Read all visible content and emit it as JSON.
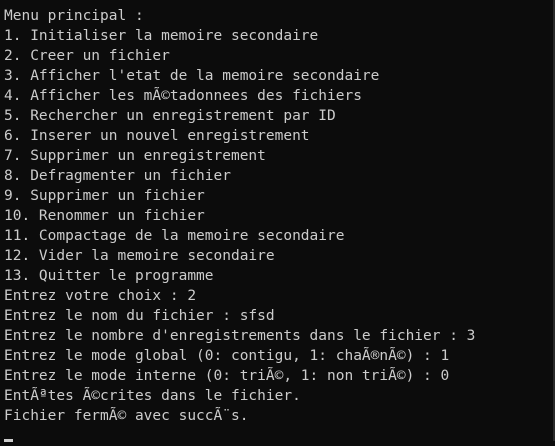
{
  "console": {
    "lines": [
      "Menu principal :",
      "1. Initialiser la memoire secondaire",
      "2. Creer un fichier",
      "3. Afficher l'etat de la memoire secondaire",
      "4. Afficher les mÃ©tadonnees des fichiers",
      "5. Rechercher un enregistrement par ID",
      "6. Inserer un nouvel enregistrement",
      "7. Supprimer un enregistrement",
      "8. Defragmenter un fichier",
      "9. Supprimer un fichier",
      "10. Renommer un fichier",
      "11. Compactage de la memoire secondaire",
      "12. Vider la memoire secondaire",
      "13. Quitter le programme",
      "Entrez votre choix : 2",
      "Entrez le nom du fichier : sfsd",
      "Entrez le nombre d'enregistrements dans le fichier : 3",
      "Entrez le mode global (0: contigu, 1: chaÃ®nÃ©) : 1",
      "Entrez le mode interne (0: triÃ©, 1: non triÃ©) : 0",
      "EntÃªtes Ã©crites dans le fichier.",
      "Fichier fermÃ© avec succÃ¨s."
    ]
  },
  "colors": {
    "background": "#0c0c0c",
    "text": "#cccccc"
  }
}
